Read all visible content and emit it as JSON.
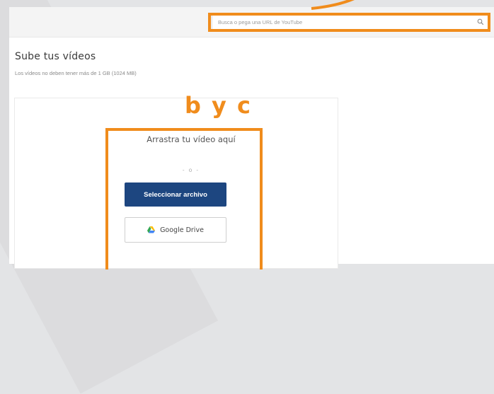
{
  "search": {
    "placeholder": "Busca o pega una URL de YouTube"
  },
  "upload": {
    "title": "Sube tus vídeos",
    "subtitle": "Los vídeos no deben tener más de 1 GB (1024 MB)",
    "drop_text": "Arrastra tu vídeo aquí",
    "divider": "- o -",
    "select_file_label": "Seleccionar archivo",
    "google_drive_label": "Google Drive"
  },
  "annotations": {
    "label": "b y c",
    "color": "#f08c1c"
  },
  "icons": {
    "search": "search-icon",
    "google_drive": "google-drive-icon"
  },
  "colors": {
    "primary_button": "#1d4680",
    "annotation": "#f08c1c"
  }
}
